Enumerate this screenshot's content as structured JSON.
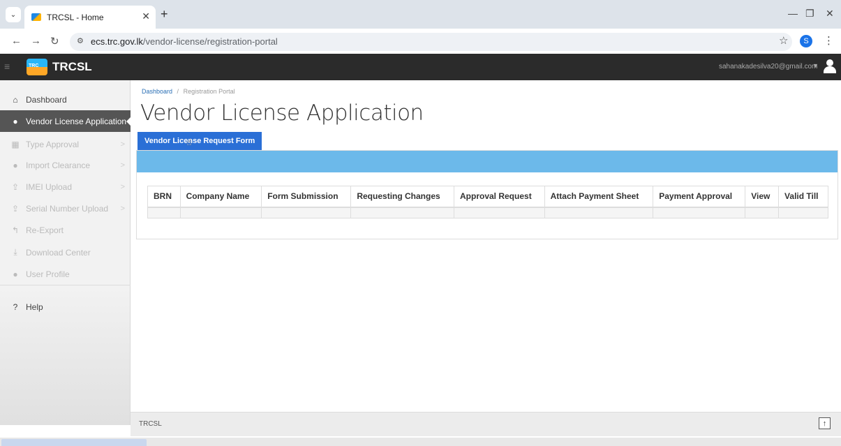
{
  "browser": {
    "tab_title": "TRCSL - Home",
    "url_host": "ecs.trc.gov.lk",
    "url_path": "/vendor-license/registration-portal",
    "profile_initial": "S"
  },
  "header": {
    "brand": "TRCSL",
    "logo_text": "TRC",
    "user_email": "sahanakadesilva20@gmail.com"
  },
  "sidebar": {
    "items": [
      {
        "label": "Dashboard",
        "icon": "home-icon",
        "state": "normal"
      },
      {
        "label": "Vendor License Application",
        "icon": "user-icon",
        "state": "active"
      },
      {
        "label": "Type Approval",
        "icon": "table-icon",
        "state": "disabled"
      },
      {
        "label": "Import Clearance",
        "icon": "circle-icon",
        "state": "disabled"
      },
      {
        "label": "IMEI Upload",
        "icon": "upload-icon",
        "state": "disabled"
      },
      {
        "label": "Serial Number Upload",
        "icon": "upload-icon",
        "state": "disabled"
      },
      {
        "label": "Re-Export",
        "icon": "reply-icon",
        "state": "disabled"
      },
      {
        "label": "Download Center",
        "icon": "download-icon",
        "state": "disabled"
      },
      {
        "label": "User Profile",
        "icon": "user-icon",
        "state": "disabled"
      },
      {
        "label": "Help",
        "icon": "help-icon",
        "state": "normal"
      }
    ]
  },
  "breadcrumb": {
    "home": "Dashboard",
    "separator": "/",
    "current": "Registration Portal"
  },
  "page": {
    "title": "Vendor License Application",
    "tab_label": "Vendor License Request Form"
  },
  "table": {
    "columns": [
      "BRN",
      "Company Name",
      "Form Submission",
      "Requesting Changes",
      "Approval Request",
      "Attach Payment Sheet",
      "Payment Approval",
      "View",
      "Valid Till"
    ]
  },
  "footer": {
    "text": "TRCSL"
  },
  "colors": {
    "header_bg": "#2b2b2b",
    "active_item_bg": "#555555",
    "tab_blue": "#2a6fd6",
    "panel_head": "#6cb9ea"
  }
}
